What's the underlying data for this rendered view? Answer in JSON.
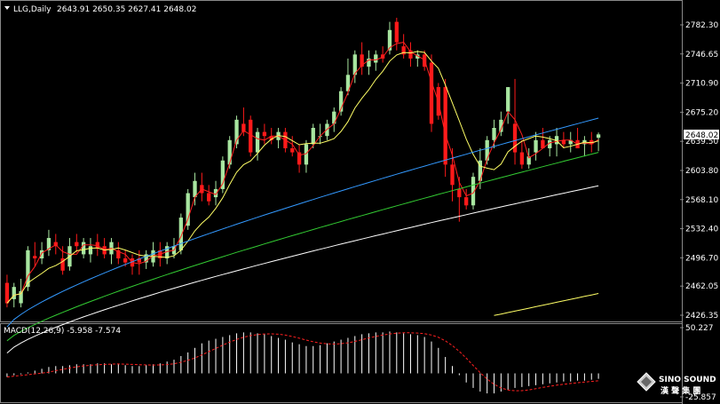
{
  "header": {
    "symbol": "LLG,Daily",
    "ohlc": "2643.91 2650.35 2627.41 2648.02"
  },
  "price_axis": {
    "ticks": [
      "2782.30",
      "2746.65",
      "2710.90",
      "2675.20",
      "2639.50",
      "2603.80",
      "2568.10",
      "2532.40",
      "2496.70",
      "2462.05",
      "2426.35"
    ],
    "current_price": "2648.02"
  },
  "macd": {
    "label": "MACD(12,26,9) -5.958 -7.574",
    "top_tick": "50.227",
    "bottom_tick": "-25.857",
    "zero_tick": "0.00"
  },
  "watermark": {
    "brand": "SINO SOUND",
    "chinese": "漢 聲 集 團"
  },
  "colors": {
    "background": "#000000",
    "bull_candle": "#a8e6a0",
    "bear_candle": "#ff1a1a",
    "ma_fast": "#ff2020",
    "ma_mid": "#ffff66",
    "ma_blue": "#3399ff",
    "ma_green": "#33cc33",
    "ma_white": "#ffffff",
    "ma_yellow_slow": "#ffff66",
    "macd_hist": "#ffffff",
    "macd_signal": "#ff2020",
    "price_tag_bg": "#ffffff",
    "price_tag_text": "#000000"
  },
  "chart_data": {
    "type": "candlestick",
    "title": "LLG,Daily",
    "ylim": [
      2426.35,
      2782.3
    ],
    "candles": [
      {
        "o": 2466,
        "h": 2476,
        "l": 2436,
        "c": 2441
      },
      {
        "o": 2446,
        "h": 2466,
        "l": 2436,
        "c": 2461
      },
      {
        "o": 2441,
        "h": 2471,
        "l": 2436,
        "c": 2456
      },
      {
        "o": 2461,
        "h": 2511,
        "l": 2456,
        "c": 2506
      },
      {
        "o": 2499,
        "h": 2516,
        "l": 2486,
        "c": 2496
      },
      {
        "o": 2496,
        "h": 2516,
        "l": 2489,
        "c": 2506
      },
      {
        "o": 2506,
        "h": 2531,
        "l": 2499,
        "c": 2521
      },
      {
        "o": 2516,
        "h": 2526,
        "l": 2501,
        "c": 2511
      },
      {
        "o": 2496,
        "h": 2511,
        "l": 2476,
        "c": 2481
      },
      {
        "o": 2486,
        "h": 2521,
        "l": 2481,
        "c": 2511
      },
      {
        "o": 2516,
        "h": 2526,
        "l": 2503,
        "c": 2511
      },
      {
        "o": 2501,
        "h": 2521,
        "l": 2496,
        "c": 2516
      },
      {
        "o": 2501,
        "h": 2521,
        "l": 2491,
        "c": 2511
      },
      {
        "o": 2516,
        "h": 2526,
        "l": 2499,
        "c": 2508
      },
      {
        "o": 2511,
        "h": 2521,
        "l": 2496,
        "c": 2501
      },
      {
        "o": 2501,
        "h": 2521,
        "l": 2489,
        "c": 2516
      },
      {
        "o": 2506,
        "h": 2516,
        "l": 2489,
        "c": 2496
      },
      {
        "o": 2496,
        "h": 2506,
        "l": 2486,
        "c": 2491
      },
      {
        "o": 2496,
        "h": 2501,
        "l": 2476,
        "c": 2486
      },
      {
        "o": 2496,
        "h": 2506,
        "l": 2476,
        "c": 2491
      },
      {
        "o": 2491,
        "h": 2506,
        "l": 2483,
        "c": 2501
      },
      {
        "o": 2491,
        "h": 2516,
        "l": 2486,
        "c": 2506
      },
      {
        "o": 2506,
        "h": 2516,
        "l": 2486,
        "c": 2496
      },
      {
        "o": 2496,
        "h": 2516,
        "l": 2489,
        "c": 2511
      },
      {
        "o": 2501,
        "h": 2521,
        "l": 2496,
        "c": 2511
      },
      {
        "o": 2506,
        "h": 2551,
        "l": 2501,
        "c": 2546
      },
      {
        "o": 2536,
        "h": 2581,
        "l": 2531,
        "c": 2576
      },
      {
        "o": 2571,
        "h": 2601,
        "l": 2561,
        "c": 2591
      },
      {
        "o": 2586,
        "h": 2601,
        "l": 2566,
        "c": 2576
      },
      {
        "o": 2576,
        "h": 2586,
        "l": 2561,
        "c": 2566
      },
      {
        "o": 2571,
        "h": 2591,
        "l": 2561,
        "c": 2581
      },
      {
        "o": 2581,
        "h": 2621,
        "l": 2576,
        "c": 2616
      },
      {
        "o": 2611,
        "h": 2646,
        "l": 2606,
        "c": 2641
      },
      {
        "o": 2636,
        "h": 2671,
        "l": 2631,
        "c": 2666
      },
      {
        "o": 2661,
        "h": 2681,
        "l": 2646,
        "c": 2651
      },
      {
        "o": 2666,
        "h": 2671,
        "l": 2621,
        "c": 2626
      },
      {
        "o": 2626,
        "h": 2656,
        "l": 2616,
        "c": 2651
      },
      {
        "o": 2651,
        "h": 2661,
        "l": 2636,
        "c": 2646
      },
      {
        "o": 2646,
        "h": 2656,
        "l": 2636,
        "c": 2641
      },
      {
        "o": 2641,
        "h": 2656,
        "l": 2631,
        "c": 2651
      },
      {
        "o": 2651,
        "h": 2656,
        "l": 2626,
        "c": 2631
      },
      {
        "o": 2631,
        "h": 2646,
        "l": 2621,
        "c": 2626
      },
      {
        "o": 2626,
        "h": 2636,
        "l": 2601,
        "c": 2611
      },
      {
        "o": 2611,
        "h": 2641,
        "l": 2601,
        "c": 2636
      },
      {
        "o": 2636,
        "h": 2661,
        "l": 2631,
        "c": 2656
      },
      {
        "o": 2646,
        "h": 2661,
        "l": 2636,
        "c": 2646
      },
      {
        "o": 2646,
        "h": 2666,
        "l": 2641,
        "c": 2661
      },
      {
        "o": 2661,
        "h": 2681,
        "l": 2651,
        "c": 2676
      },
      {
        "o": 2676,
        "h": 2706,
        "l": 2671,
        "c": 2701
      },
      {
        "o": 2701,
        "h": 2741,
        "l": 2696,
        "c": 2721
      },
      {
        "o": 2721,
        "h": 2751,
        "l": 2711,
        "c": 2746
      },
      {
        "o": 2746,
        "h": 2761,
        "l": 2721,
        "c": 2731
      },
      {
        "o": 2731,
        "h": 2751,
        "l": 2721,
        "c": 2741
      },
      {
        "o": 2736,
        "h": 2751,
        "l": 2726,
        "c": 2746
      },
      {
        "o": 2746,
        "h": 2756,
        "l": 2736,
        "c": 2741
      },
      {
        "o": 2751,
        "h": 2786,
        "l": 2746,
        "c": 2776
      },
      {
        "o": 2786,
        "h": 2791,
        "l": 2751,
        "c": 2761
      },
      {
        "o": 2756,
        "h": 2771,
        "l": 2741,
        "c": 2746
      },
      {
        "o": 2751,
        "h": 2761,
        "l": 2731,
        "c": 2741
      },
      {
        "o": 2741,
        "h": 2751,
        "l": 2731,
        "c": 2746
      },
      {
        "o": 2746,
        "h": 2751,
        "l": 2726,
        "c": 2731
      },
      {
        "o": 2736,
        "h": 2746,
        "l": 2651,
        "c": 2661
      },
      {
        "o": 2706,
        "h": 2711,
        "l": 2666,
        "c": 2671
      },
      {
        "o": 2706,
        "h": 2716,
        "l": 2596,
        "c": 2611
      },
      {
        "o": 2611,
        "h": 2631,
        "l": 2566,
        "c": 2586
      },
      {
        "o": 2581,
        "h": 2596,
        "l": 2541,
        "c": 2571
      },
      {
        "o": 2571,
        "h": 2581,
        "l": 2556,
        "c": 2561
      },
      {
        "o": 2561,
        "h": 2601,
        "l": 2556,
        "c": 2596
      },
      {
        "o": 2591,
        "h": 2631,
        "l": 2581,
        "c": 2616
      },
      {
        "o": 2616,
        "h": 2646,
        "l": 2611,
        "c": 2641
      },
      {
        "o": 2641,
        "h": 2666,
        "l": 2631,
        "c": 2656
      },
      {
        "o": 2651,
        "h": 2676,
        "l": 2646,
        "c": 2666
      },
      {
        "o": 2676,
        "h": 2706,
        "l": 2661,
        "c": 2706
      },
      {
        "o": 2661,
        "h": 2716,
        "l": 2611,
        "c": 2626
      },
      {
        "o": 2626,
        "h": 2641,
        "l": 2606,
        "c": 2611
      },
      {
        "o": 2611,
        "h": 2631,
        "l": 2606,
        "c": 2621
      },
      {
        "o": 2626,
        "h": 2651,
        "l": 2616,
        "c": 2641
      },
      {
        "o": 2641,
        "h": 2656,
        "l": 2631,
        "c": 2631
      },
      {
        "o": 2631,
        "h": 2646,
        "l": 2621,
        "c": 2641
      },
      {
        "o": 2636,
        "h": 2656,
        "l": 2621,
        "c": 2646
      },
      {
        "o": 2641,
        "h": 2651,
        "l": 2631,
        "c": 2636
      },
      {
        "o": 2636,
        "h": 2651,
        "l": 2626,
        "c": 2641
      },
      {
        "o": 2641,
        "h": 2656,
        "l": 2631,
        "c": 2631
      },
      {
        "o": 2636,
        "h": 2646,
        "l": 2621,
        "c": 2641
      },
      {
        "o": 2641,
        "h": 2651,
        "l": 2626,
        "c": 2636
      },
      {
        "o": 2643.91,
        "h": 2650.35,
        "l": 2627.41,
        "c": 2648.02
      }
    ],
    "macd_histogram": [
      -4,
      -2,
      -1,
      1,
      3,
      5,
      7,
      8,
      8,
      9,
      10,
      10,
      10,
      11,
      11,
      10,
      10,
      9,
      8,
      8,
      9,
      10,
      11,
      13,
      15,
      19,
      23,
      28,
      33,
      36,
      38,
      40,
      42,
      44,
      45,
      45,
      44,
      43,
      41,
      39,
      37,
      34,
      32,
      30,
      30,
      31,
      33,
      35,
      37,
      39,
      41,
      43,
      44,
      45,
      45,
      46,
      45,
      44,
      43,
      42,
      40,
      35,
      28,
      18,
      8,
      -2,
      -10,
      -16,
      -20,
      -22,
      -22,
      -20,
      -18,
      -16,
      -15,
      -14,
      -13,
      -12,
      -11,
      -10,
      -9,
      -9,
      -8,
      -8,
      -7,
      -6
    ]
  }
}
